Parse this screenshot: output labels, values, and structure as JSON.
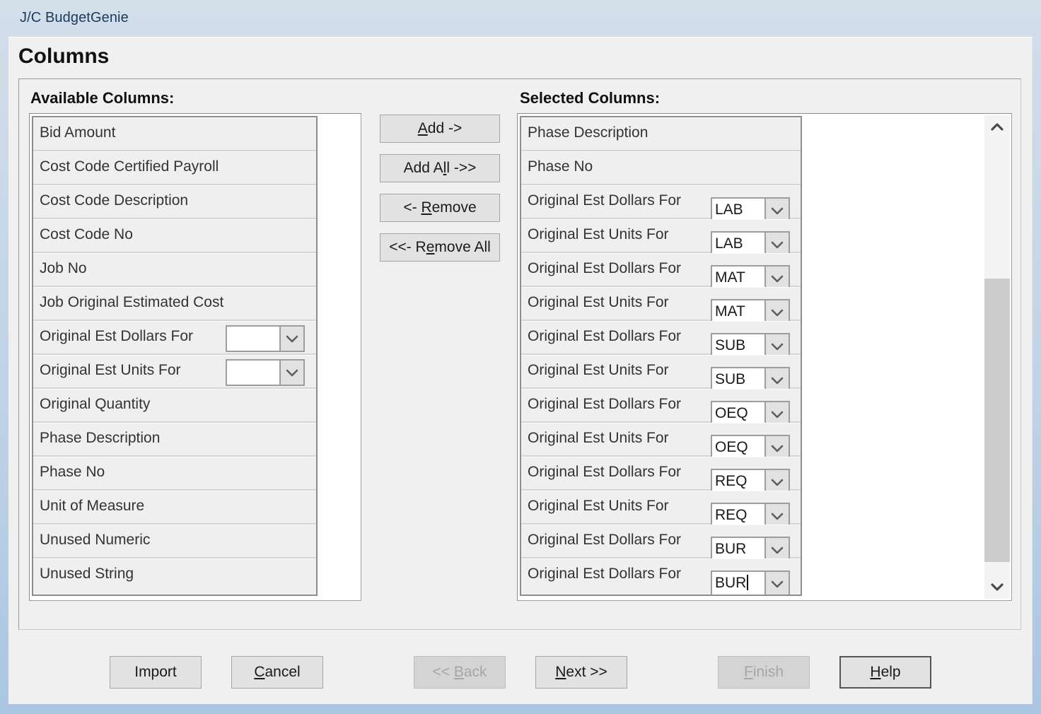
{
  "window": {
    "title": "J/C BudgetGenie",
    "page_title": "Columns",
    "accent_titlebar": "#b8cfe8",
    "face_color": "#f0f0f0"
  },
  "available": {
    "heading": "Available Columns:",
    "items": [
      {
        "label": "Bid Amount",
        "combo": null
      },
      {
        "label": "Cost Code Certified Payroll",
        "combo": null
      },
      {
        "label": "Cost Code Description",
        "combo": null
      },
      {
        "label": "Cost Code No",
        "combo": null
      },
      {
        "label": "Job No",
        "combo": null
      },
      {
        "label": "Job Original Estimated Cost",
        "combo": null
      },
      {
        "label": "Original Est Dollars For",
        "combo": ""
      },
      {
        "label": "Original Est Units For",
        "combo": ""
      },
      {
        "label": "Original Quantity",
        "combo": null
      },
      {
        "label": "Phase Description",
        "combo": null
      },
      {
        "label": "Phase No",
        "combo": null
      },
      {
        "label": "Unit of Measure",
        "combo": null
      },
      {
        "label": "Unused Numeric",
        "combo": null
      },
      {
        "label": "Unused String",
        "combo": null
      }
    ]
  },
  "selected": {
    "heading": "Selected Columns:",
    "items": [
      {
        "label": "Phase Description",
        "combo": null,
        "editing": false
      },
      {
        "label": "Phase No",
        "combo": null,
        "editing": false
      },
      {
        "label": "Original Est Dollars For",
        "combo": "LAB",
        "editing": false
      },
      {
        "label": "Original Est Units For",
        "combo": "LAB",
        "editing": false
      },
      {
        "label": "Original Est Dollars For",
        "combo": "MAT",
        "editing": false
      },
      {
        "label": "Original Est Units For",
        "combo": "MAT",
        "editing": false
      },
      {
        "label": "Original Est Dollars For",
        "combo": "SUB",
        "editing": false
      },
      {
        "label": "Original Est Units For",
        "combo": "SUB",
        "editing": false
      },
      {
        "label": "Original Est Dollars For",
        "combo": "OEQ",
        "editing": false
      },
      {
        "label": "Original Est Units For",
        "combo": "OEQ",
        "editing": false
      },
      {
        "label": "Original Est Dollars For",
        "combo": "REQ",
        "editing": false
      },
      {
        "label": "Original Est Units For",
        "combo": "REQ",
        "editing": false
      },
      {
        "label": "Original Est Dollars For",
        "combo": "BUR",
        "editing": false
      },
      {
        "label": "Original Est Dollars For",
        "combo": "BUR",
        "editing": true
      }
    ],
    "scrollbar": {
      "up_arrow": "chevron-up-icon",
      "down_arrow": "chevron-down-icon",
      "thumb_top_pct": 32,
      "thumb_height_pct": 65
    }
  },
  "transfer_buttons": [
    {
      "name": "add-button",
      "pre": "",
      "accel": "A",
      "post": "dd ->"
    },
    {
      "name": "add-all-button",
      "pre": "Add A",
      "accel": "l",
      "post": "l ->>"
    },
    {
      "name": "remove-button",
      "pre": "<- ",
      "accel": "R",
      "post": "emove"
    },
    {
      "name": "remove-all-button",
      "pre": "<<- R",
      "accel": "e",
      "post": "move All"
    }
  ],
  "wizard_buttons": [
    {
      "name": "import-button",
      "pre": "Import",
      "accel": "",
      "post": "",
      "disabled": false,
      "default": false
    },
    {
      "name": "cancel-button",
      "pre": "",
      "accel": "C",
      "post": "ancel",
      "disabled": false,
      "default": false
    },
    {
      "name": "back-button",
      "pre": "<< ",
      "accel": "B",
      "post": "ack",
      "disabled": true,
      "default": false
    },
    {
      "name": "next-button",
      "pre": "",
      "accel": "N",
      "post": "ext >>",
      "disabled": false,
      "default": false
    },
    {
      "name": "finish-button",
      "pre": "",
      "accel": "F",
      "post": "inish",
      "disabled": true,
      "default": false
    },
    {
      "name": "help-button",
      "pre": "",
      "accel": "H",
      "post": "elp",
      "disabled": false,
      "default": true
    }
  ]
}
